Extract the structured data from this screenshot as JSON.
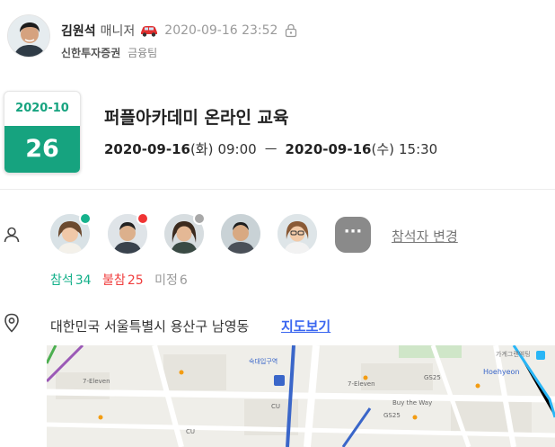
{
  "author": {
    "name": "김원석",
    "title": "매니저",
    "timestamp": "2020-09-16 23:52",
    "company": "신한투자증권",
    "team": "금융팀"
  },
  "event": {
    "date_box": {
      "year_month": "2020-10",
      "day": "26"
    },
    "title": "퍼플아카데미 온라인 교육",
    "start_date": "2020-09-16",
    "start_weekday": "(화)",
    "start_time": "09:00",
    "separator": "ㅡ",
    "end_date": "2020-09-16",
    "end_weekday": "(수)",
    "end_time": "15:30"
  },
  "attendees": {
    "list": [
      {
        "status_color": "#16b28c"
      },
      {
        "status_color": "#f03434"
      },
      {
        "status_color": "#a8a8a8"
      },
      {
        "status_color": ""
      },
      {
        "status_color": ""
      }
    ],
    "more_label": "···",
    "change_label": "참석자 변경",
    "counts": {
      "attending_label": "참석",
      "attending": "34",
      "declined_label": "불참",
      "declined": "25",
      "undecided_label": "미정",
      "undecided": "6"
    }
  },
  "location": {
    "address": "대한민국 서울특별시 용산구 남영동",
    "map_link": "지도보기",
    "map_labels": {
      "subway": "숙대입구역",
      "hoehyeon": "Hoehyeon",
      "guests": "가계그랜엑팅",
      "gs25_a": "GS25",
      "gs25_b": "GS25",
      "cu_a": "CU",
      "cu_b": "CU",
      "eleven_a": "7-Eleven",
      "eleven_b": "7-Eleven",
      "buy": "Buy the Way"
    }
  },
  "colors": {
    "accent": "#16a37f",
    "attending": "#14b08a",
    "declined": "#f03e3e",
    "link": "#3a66f0"
  }
}
